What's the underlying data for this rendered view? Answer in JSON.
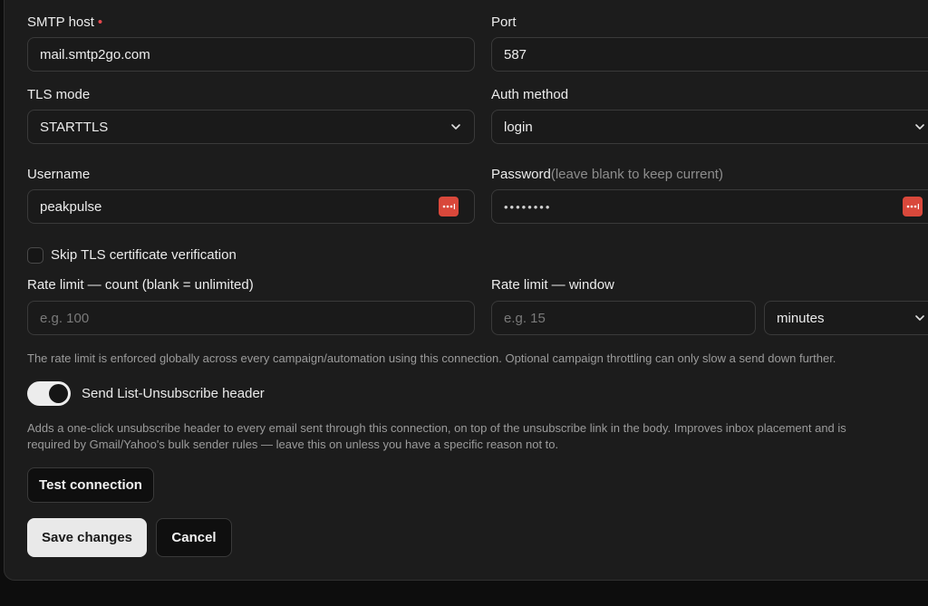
{
  "smtp_host": {
    "label": "SMTP host",
    "required_mark": "•",
    "value": "mail.smtp2go.com"
  },
  "port": {
    "label": "Port",
    "value": "587"
  },
  "tls_mode": {
    "label": "TLS mode",
    "value": "STARTTLS"
  },
  "auth_method": {
    "label": "Auth method",
    "value": "login"
  },
  "username": {
    "label": "Username",
    "value": "peakpulse"
  },
  "password": {
    "label": "Password",
    "hint": "(leave blank to keep current)",
    "value": "••••••••"
  },
  "skip_tls": {
    "label": "Skip TLS certificate verification",
    "checked": false
  },
  "rate_count": {
    "label": "Rate limit — count (blank = unlimited)",
    "placeholder": "e.g. 100"
  },
  "rate_window": {
    "label": "Rate limit — window",
    "placeholder": "e.g. 15",
    "unit": "minutes"
  },
  "rate_help": "The rate limit is enforced globally across every campaign/automation using this connection. Optional campaign throttling can only slow a send down further.",
  "unsubscribe": {
    "label": "Send List-Unsubscribe header",
    "enabled": true,
    "help_line1": "Adds a one-click unsubscribe header to every email sent through this connection, on top of the unsubscribe link in the body. Improves inbox placement and is",
    "help_line2": "required by Gmail/Yahoo's bulk sender rules — leave this on unless you have a specific reason not to."
  },
  "buttons": {
    "test": "Test connection",
    "save": "Save changes",
    "cancel": "Cancel"
  },
  "colors": {
    "background": "#0d0d0d",
    "panel": "#1c1c1c",
    "required": "#e5484d",
    "password_manager_badge": "#d9483b",
    "toggle_on": "#ececec"
  },
  "icons": {
    "select": "chevron-down-icon",
    "password_manager": "password-manager-icon"
  }
}
